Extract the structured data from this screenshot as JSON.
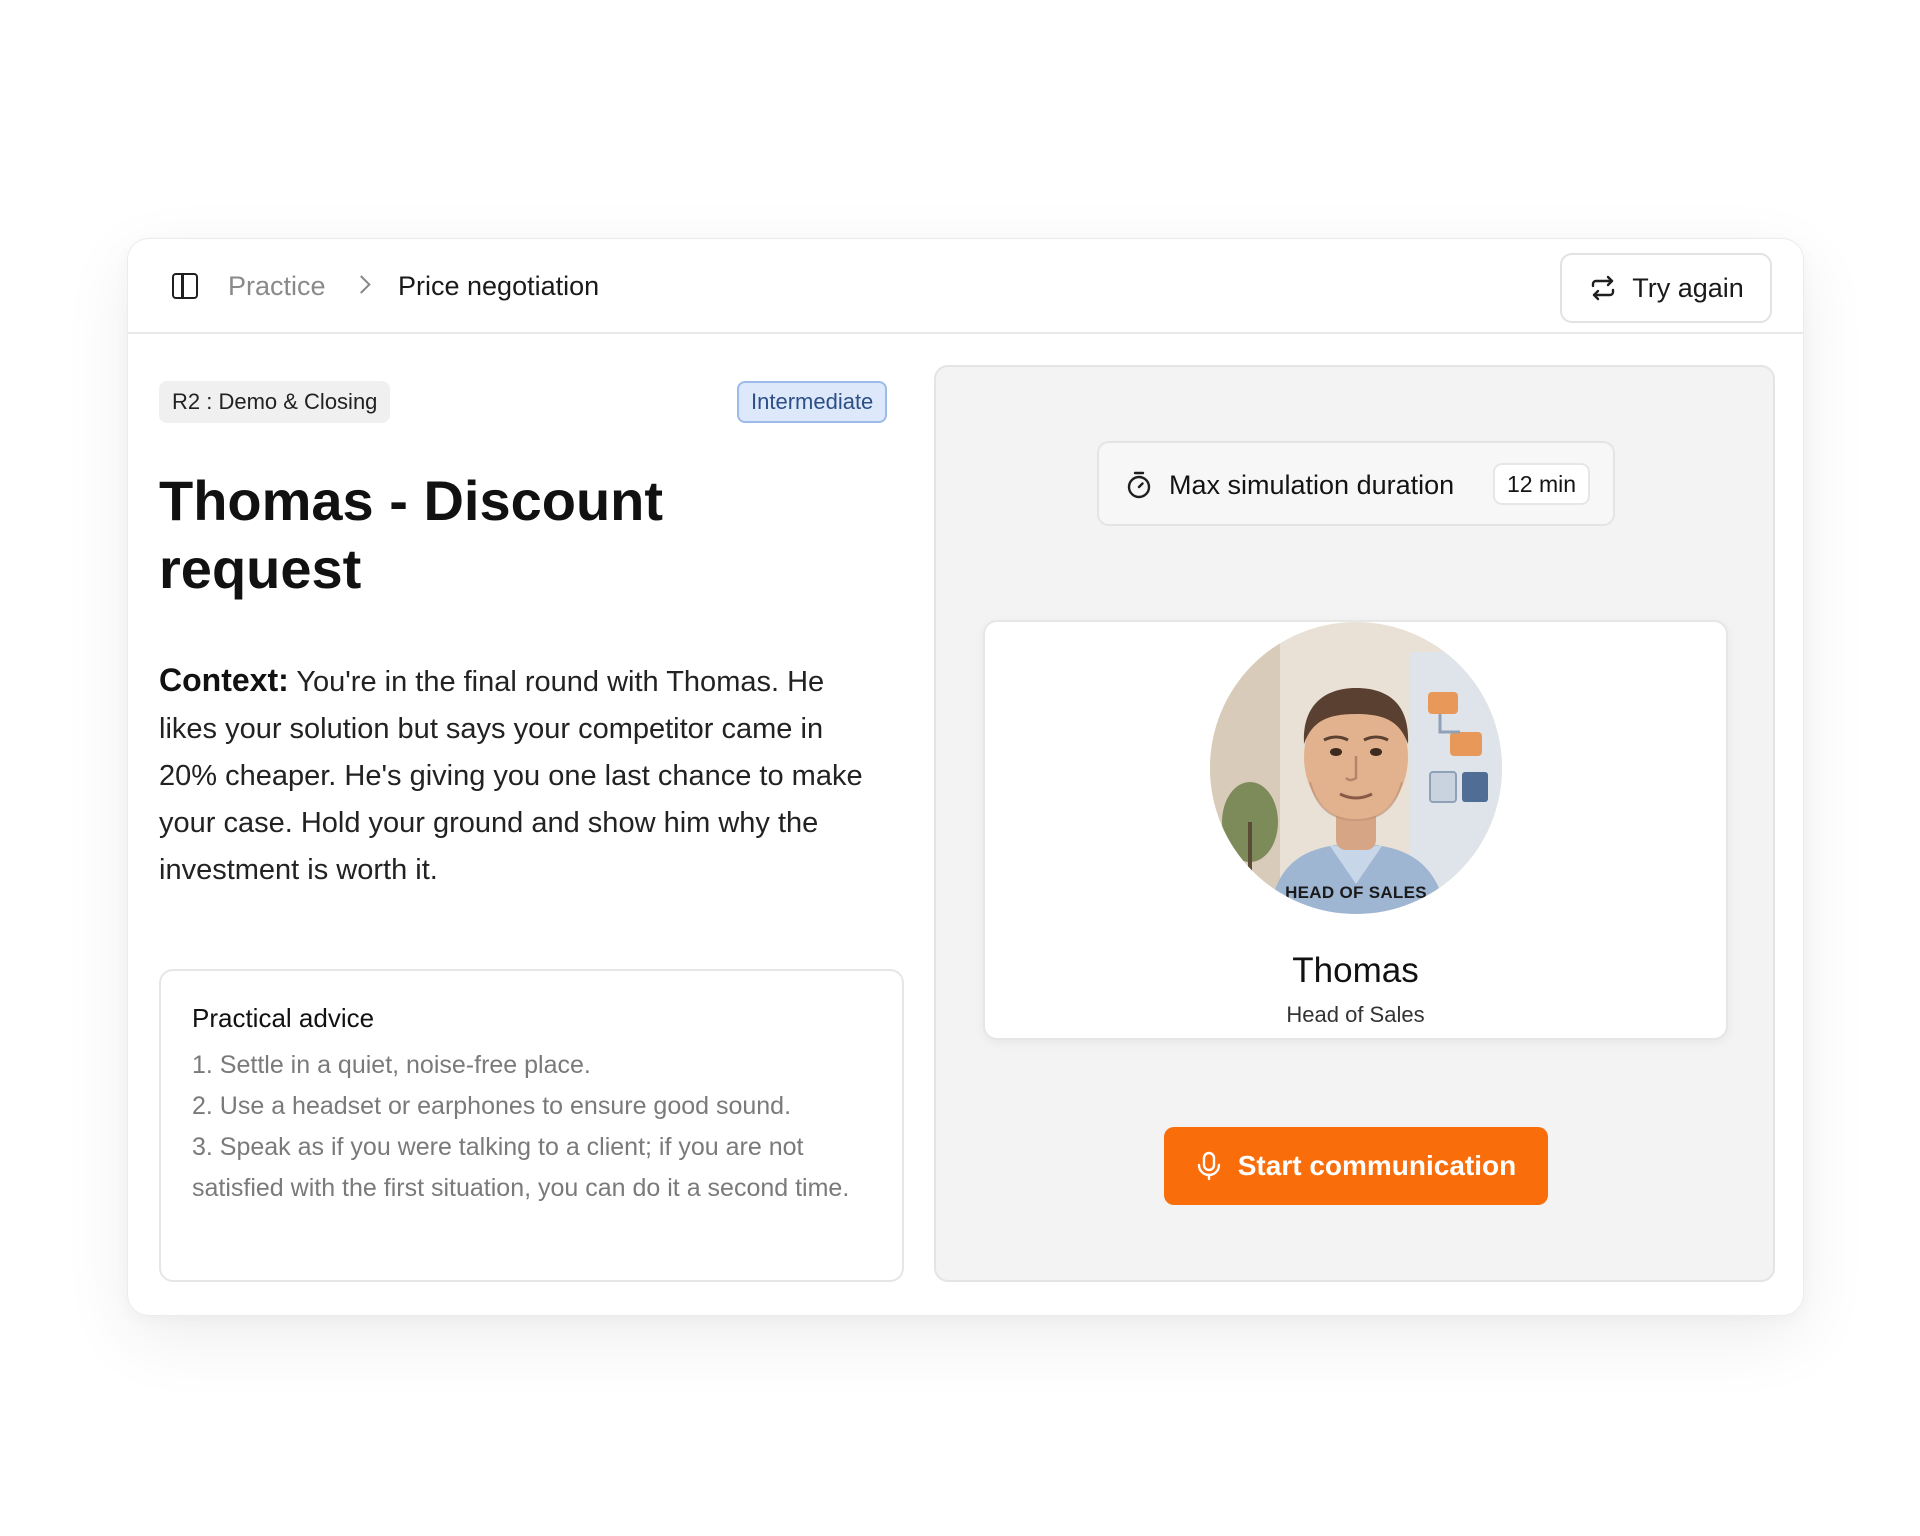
{
  "header": {
    "breadcrumb_root": "Practice",
    "breadcrumb_current": "Price negotiation",
    "try_again_label": "Try again"
  },
  "scenario": {
    "round_tag": "R2 : Demo & Closing",
    "difficulty": "Intermediate",
    "title": "Thomas - Discount request",
    "context_label": "Context:",
    "context_text": "You're in the final round with Thomas. He likes your solution but says your competitor came in 20% cheaper. He's giving you one last chance to make your case. Hold your ground and show him why the investment is worth it."
  },
  "advice": {
    "heading": "Practical advice",
    "items": [
      "1. Settle in a quiet, noise-free place.",
      "2. Use a headset or earphones to ensure good sound.",
      "3. Speak as if you were talking to a client; if you are not satisfied with the first situation, you can do it a second time."
    ]
  },
  "simulation": {
    "duration_label": "Max simulation duration",
    "duration_value": "12 min"
  },
  "persona": {
    "avatar_caption": "HEAD OF SALES",
    "name": "Thomas",
    "role": "Head of Sales"
  },
  "actions": {
    "start_label": "Start communication"
  },
  "colors": {
    "accent": "#f96d0b",
    "difficulty_bg": "#dde9fb",
    "difficulty_border": "#9dbbe8"
  },
  "icons": [
    "sidebar-toggle-icon",
    "chevron-right-icon",
    "repeat-icon",
    "timer-icon",
    "microphone-icon"
  ]
}
